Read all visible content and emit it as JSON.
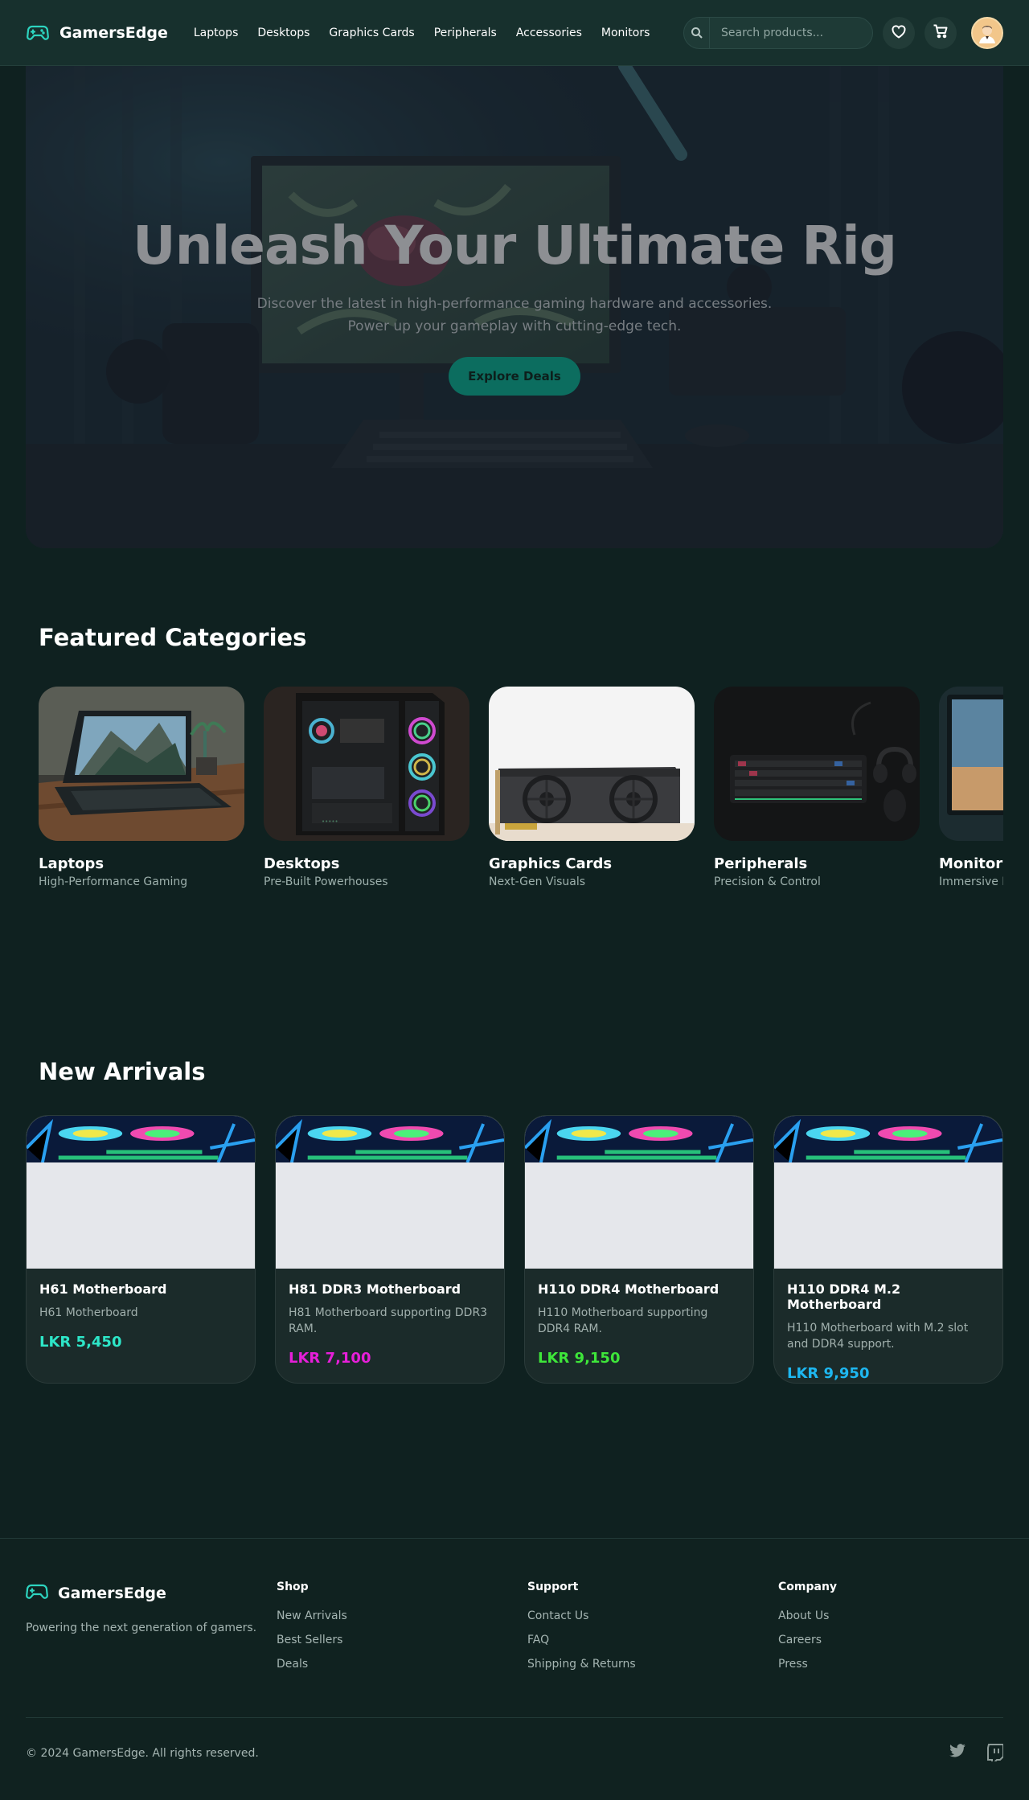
{
  "header": {
    "brand": "GamersEdge",
    "nav": [
      "Laptops",
      "Desktops",
      "Graphics Cards",
      "Peripherals",
      "Accessories",
      "Monitors"
    ],
    "search_placeholder": "Search products...",
    "accent": "#2dd4bf"
  },
  "hero": {
    "title": "Unleash Your Ultimate Rig",
    "subtitle_line1": "Discover the latest in high-performance gaming hardware and accessories.",
    "subtitle_line2": "Power up your gameplay with cutting-edge tech.",
    "cta": "Explore Deals"
  },
  "categories": {
    "title": "Featured Categories",
    "items": [
      {
        "name": "Laptops",
        "desc": "High-Performance Gaming"
      },
      {
        "name": "Desktops",
        "desc": "Pre-Built Powerhouses"
      },
      {
        "name": "Graphics Cards",
        "desc": "Next-Gen Visuals"
      },
      {
        "name": "Peripherals",
        "desc": "Precision & Control"
      },
      {
        "name": "Monitors",
        "desc": "Immersive D"
      }
    ]
  },
  "arrivals": {
    "title": "New Arrivals",
    "items": [
      {
        "name": "H61 Motherboard",
        "desc": "H61 Motherboard",
        "price": "LKR 5,450",
        "price_color": "#2de6c8"
      },
      {
        "name": "H81 DDR3 Motherboard",
        "desc": "H81 Motherboard supporting DDR3 RAM.",
        "price": "LKR 7,100",
        "price_color": "#e61fd9"
      },
      {
        "name": "H110 DDR4 Motherboard",
        "desc": "H110 Motherboard supporting DDR4 RAM.",
        "price": "LKR 9,150",
        "price_color": "#3ee63a"
      },
      {
        "name": "H110 DDR4 M.2 Motherboard",
        "desc": "H110 Motherboard with M.2 slot and DDR4 support.",
        "price": "LKR 9,950",
        "price_color": "#1eb7f0"
      }
    ]
  },
  "footer": {
    "brand": "GamersEdge",
    "tagline": "Powering the next generation of gamers.",
    "columns": [
      {
        "title": "Shop",
        "links": [
          "New Arrivals",
          "Best Sellers",
          "Deals"
        ]
      },
      {
        "title": "Support",
        "links": [
          "Contact Us",
          "FAQ",
          "Shipping & Returns"
        ]
      },
      {
        "title": "Company",
        "links": [
          "About Us",
          "Careers",
          "Press"
        ]
      }
    ],
    "copyright": "© 2024 GamersEdge. All rights reserved.",
    "socials": [
      "twitter-icon",
      "twitch-icon"
    ]
  }
}
